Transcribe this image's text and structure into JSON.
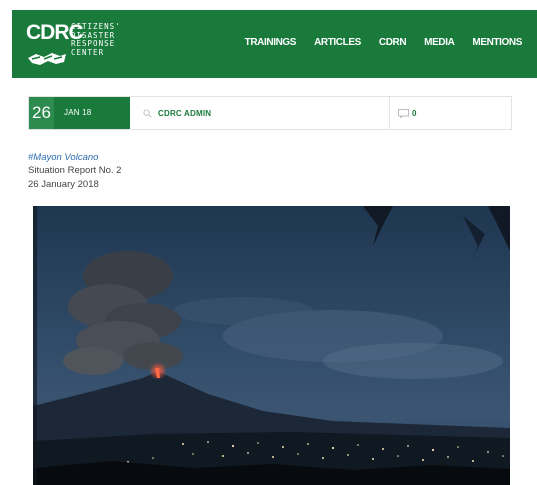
{
  "header": {
    "logo": {
      "abbr": "CDRC",
      "words": [
        "CITIZENS'",
        "DISASTER",
        "RESPONSE",
        "CENTER"
      ]
    },
    "nav": [
      {
        "label": "TRAININGS"
      },
      {
        "label": "ARTICLES"
      },
      {
        "label": "CDRN"
      },
      {
        "label": "MEDIA"
      },
      {
        "label": "MENTIONS"
      }
    ]
  },
  "meta": {
    "day": "26",
    "month_year": "JAN 18",
    "author_icon": "search-icon",
    "author": "CDRC ADMIN",
    "comment_icon": "comment-icon",
    "comment_count": "0"
  },
  "article": {
    "tag": "#Mayon Volcano",
    "subtitle": "Situation Report No. 2",
    "date": "26 January 2018"
  },
  "colors": {
    "brand_green": "#1a7a3c",
    "day_green": "#2e8b4f",
    "link_blue": "#2b6cb0"
  }
}
